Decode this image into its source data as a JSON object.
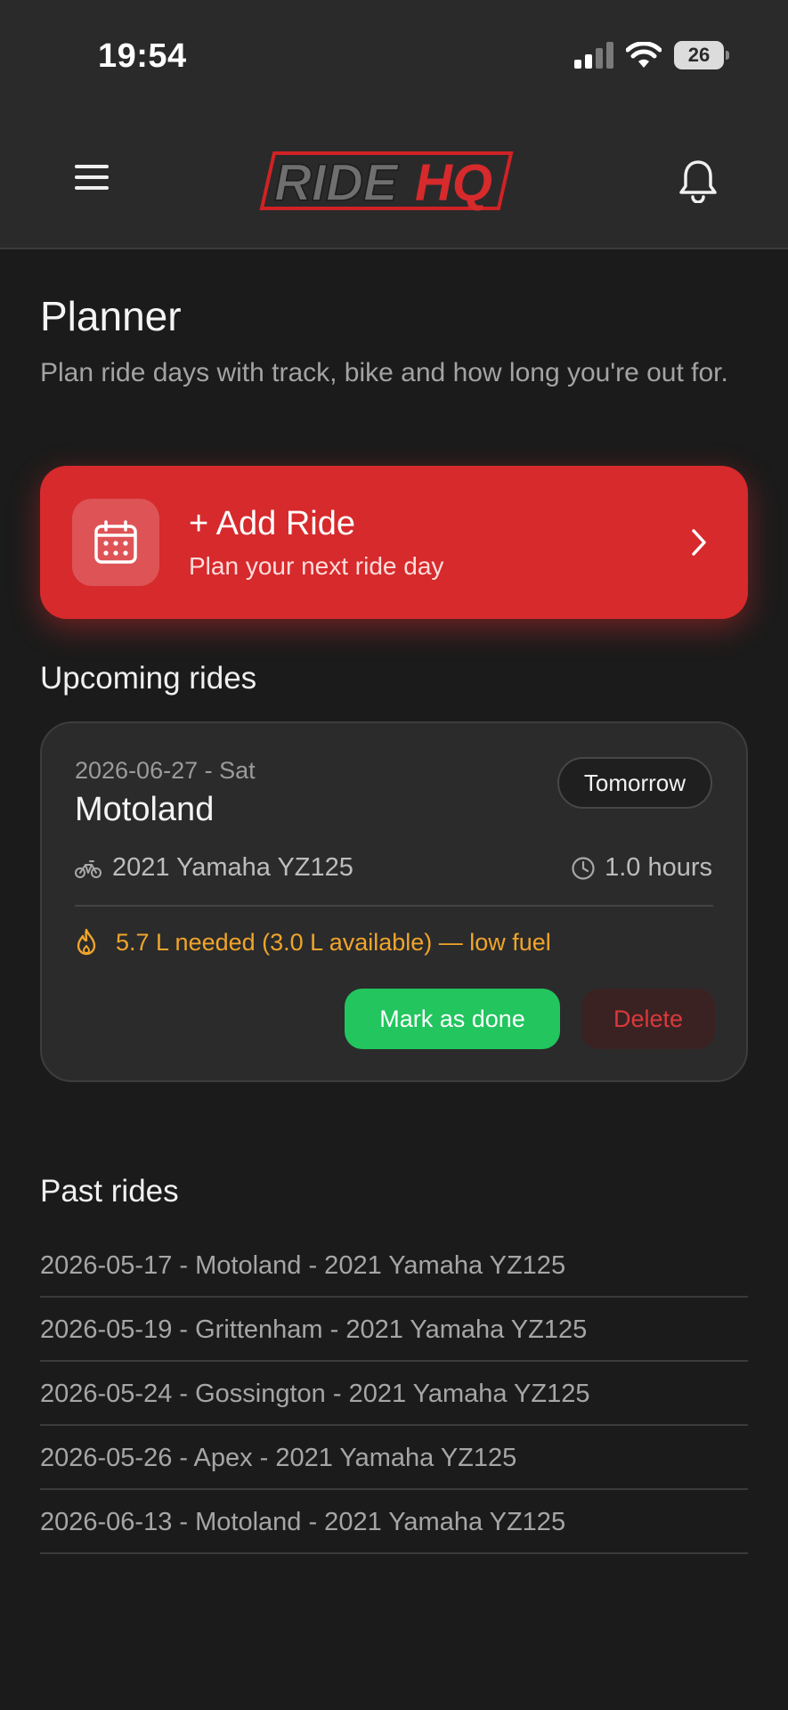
{
  "status_bar": {
    "time": "19:54",
    "battery_level": "26",
    "icons": [
      "signal-icon",
      "wifi-icon",
      "battery-icon"
    ]
  },
  "header": {
    "logo_text_part1": "RIDE",
    "logo_text_part2": "HQ",
    "icons": [
      "menu-icon",
      "bell-icon"
    ]
  },
  "page": {
    "title": "Planner",
    "subtitle": "Plan ride days with track, bike and how long you're out for."
  },
  "add_ride": {
    "title": "+ Add Ride",
    "subtitle": "Plan your next ride day",
    "icons": [
      "calendar-icon",
      "chevron-right-icon"
    ]
  },
  "upcoming": {
    "section_title": "Upcoming rides",
    "rides": [
      {
        "date": "2026-06-27 - Sat",
        "track": "Motoland",
        "badge": "Tomorrow",
        "bike": "2021 Yamaha YZ125",
        "duration": "1.0 hours",
        "fuel_warning": "5.7 L needed (3.0 L available) — low fuel",
        "done_label": "Mark as done",
        "delete_label": "Delete"
      }
    ]
  },
  "past": {
    "section_title": "Past rides",
    "items": [
      "2026-05-17 - Motoland - 2021 Yamaha YZ125",
      "2026-05-19 - Grittenham - 2021 Yamaha YZ125",
      "2026-05-24 - Gossington - 2021 Yamaha YZ125",
      "2026-05-26 - Apex - 2021 Yamaha YZ125",
      "2026-06-13 - Motoland - 2021 Yamaha YZ125"
    ]
  },
  "colors": {
    "background": "#1b1b1b",
    "header": "#2a2a2b",
    "accent_red": "#d62a2c",
    "success_green": "#22c55e",
    "warning_amber": "#f0a52a",
    "card": "#2b2b2c"
  }
}
